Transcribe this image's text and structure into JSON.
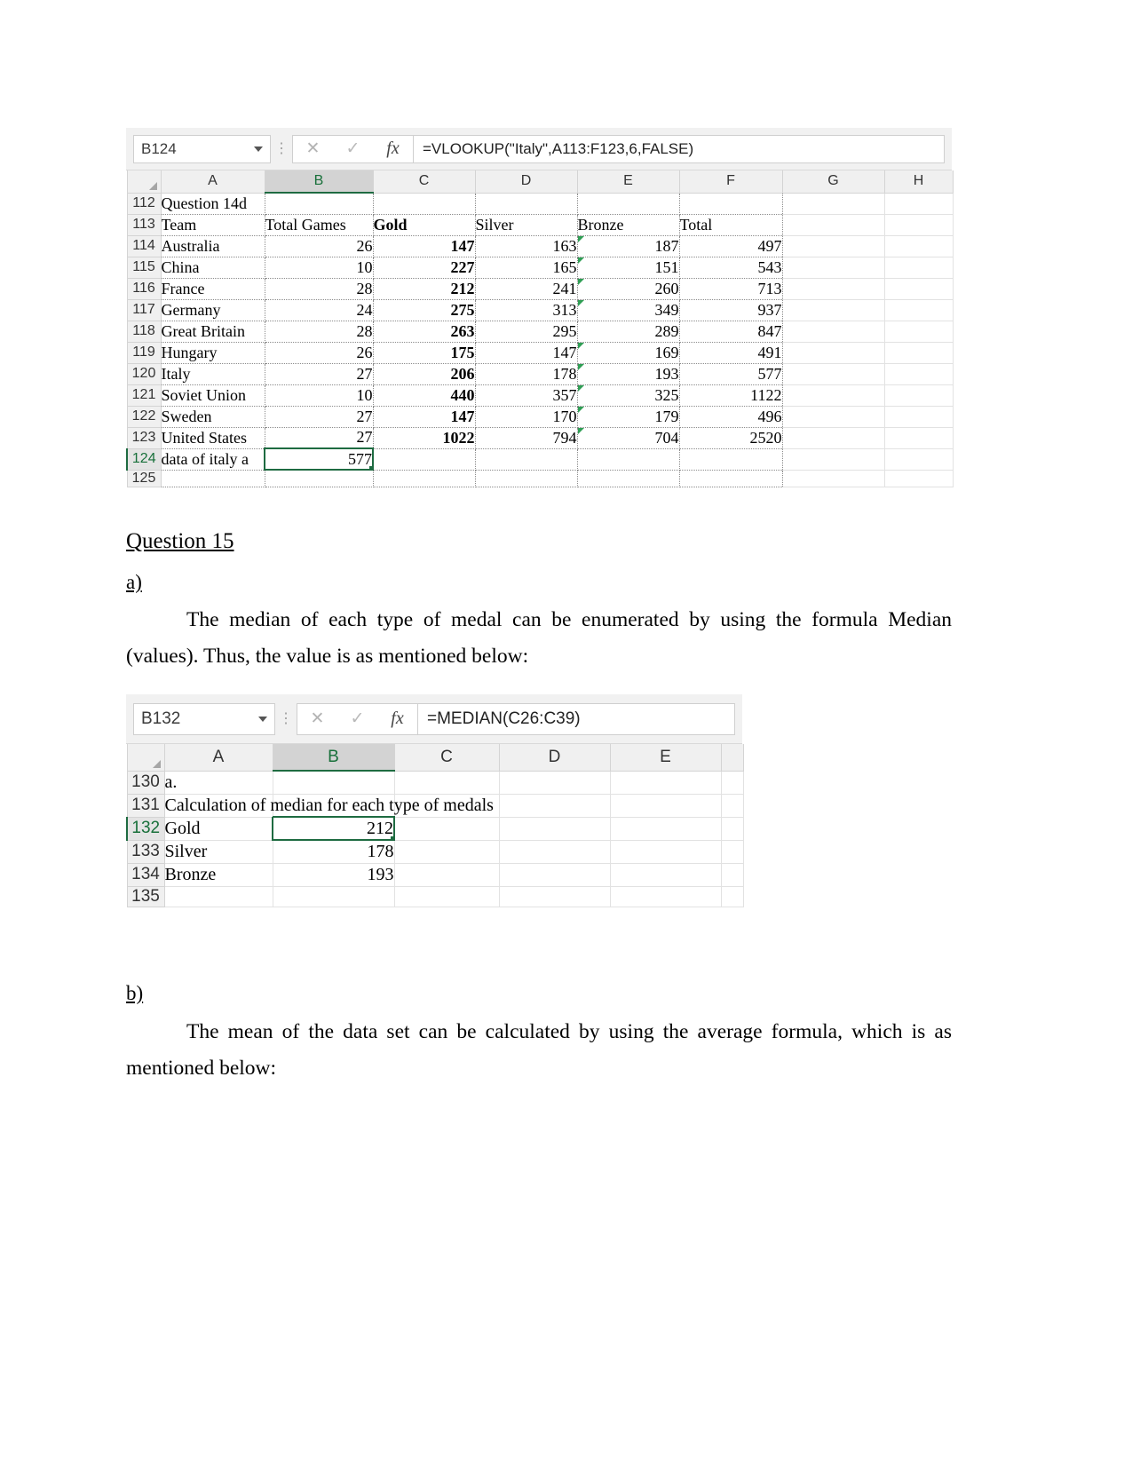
{
  "spreadsheet_1": {
    "name_box": "B124",
    "formula": "=VLOOKUP(\"Italy\",A113:F123,6,FALSE)",
    "icons": {
      "cancel": "✕",
      "enter": "✓",
      "fx": "fx",
      "dropdown": "chevron-down-icon",
      "menu": "⋮"
    },
    "column_headers": [
      "A",
      "B",
      "C",
      "D",
      "E",
      "F",
      "G",
      "H"
    ],
    "selected_column": "B",
    "selected_cell": "B124",
    "row_numbers": [
      "112",
      "113",
      "114",
      "115",
      "116",
      "117",
      "118",
      "119",
      "120",
      "121",
      "122",
      "123",
      "124",
      "125"
    ],
    "rows": [
      {
        "n": "112",
        "cells": [
          "Question 14d",
          "",
          "",
          "",
          "",
          "",
          "",
          ""
        ]
      },
      {
        "n": "113",
        "cells": [
          "Team",
          "Total Games",
          "Gold",
          "Silver",
          "Bronze",
          "Total",
          "",
          ""
        ]
      },
      {
        "n": "114",
        "cells": [
          "Australia",
          "26",
          "147",
          "163",
          "187",
          "497",
          "",
          ""
        ]
      },
      {
        "n": "115",
        "cells": [
          "China",
          "10",
          "227",
          "165",
          "151",
          "543",
          "",
          ""
        ]
      },
      {
        "n": "116",
        "cells": [
          "France",
          "28",
          "212",
          "241",
          "260",
          "713",
          "",
          ""
        ]
      },
      {
        "n": "117",
        "cells": [
          "Germany",
          "24",
          "275",
          "313",
          "349",
          "937",
          "",
          ""
        ]
      },
      {
        "n": "118",
        "cells": [
          "Great Britain",
          "28",
          "263",
          "295",
          "289",
          "847",
          "",
          ""
        ]
      },
      {
        "n": "119",
        "cells": [
          "Hungary",
          "26",
          "175",
          "147",
          "169",
          "491",
          "",
          ""
        ]
      },
      {
        "n": "120",
        "cells": [
          "Italy",
          "27",
          "206",
          "178",
          "193",
          "577",
          "",
          ""
        ]
      },
      {
        "n": "121",
        "cells": [
          "Soviet Union",
          "10",
          "440",
          "357",
          "325",
          "1122",
          "",
          ""
        ]
      },
      {
        "n": "122",
        "cells": [
          "Sweden",
          "27",
          "147",
          "170",
          "179",
          "496",
          "",
          ""
        ]
      },
      {
        "n": "123",
        "cells": [
          "United States",
          "27",
          "1022",
          "794",
          "704",
          "2520",
          "",
          ""
        ]
      },
      {
        "n": "124",
        "cells": [
          "data of italy a",
          "577",
          "",
          "",
          "",
          "",
          "",
          ""
        ]
      },
      {
        "n": "125",
        "cells": [
          "",
          "",
          "",
          "",
          "",
          "",
          "",
          ""
        ]
      }
    ]
  },
  "spreadsheet_2": {
    "name_box": "B132",
    "formula": "=MEDIAN(C26:C39)",
    "icons": {
      "cancel": "✕",
      "enter": "✓",
      "fx": "fx",
      "dropdown": "chevron-down-icon",
      "menu": "⋮"
    },
    "column_headers": [
      "A",
      "B",
      "C",
      "D",
      "E"
    ],
    "selected_column": "B",
    "selected_cell": "B132",
    "rows": [
      {
        "n": "130",
        "cells": [
          "a.",
          "",
          "",
          "",
          ""
        ]
      },
      {
        "n": "131",
        "cells": [
          "Calculation of median for each type of medals",
          "",
          "",
          "",
          ""
        ]
      },
      {
        "n": "132",
        "cells": [
          "Gold",
          "212",
          "",
          "",
          ""
        ]
      },
      {
        "n": "133",
        "cells": [
          "Silver",
          "178",
          "",
          "",
          ""
        ]
      },
      {
        "n": "134",
        "cells": [
          "Bronze",
          "193",
          "",
          "",
          ""
        ]
      },
      {
        "n": "135",
        "cells": [
          "",
          "",
          "",
          "",
          ""
        ]
      }
    ]
  },
  "document": {
    "question_heading": "Question 15",
    "part_a_label": "a)",
    "part_a_text": "The median of each type of medal can be enumerated by using the formula Median (values). Thus, the value is as mentioned below:",
    "part_b_label": "b)",
    "part_b_text": "The mean of the data set can be calculated by using the average formula, which is as mentioned below:"
  },
  "colors": {
    "excel_green": "#1e6b41",
    "header_gray": "#f0f0f0",
    "selected_col_gray": "#d3d3d3",
    "error_flag_green": "#2f9e54"
  }
}
